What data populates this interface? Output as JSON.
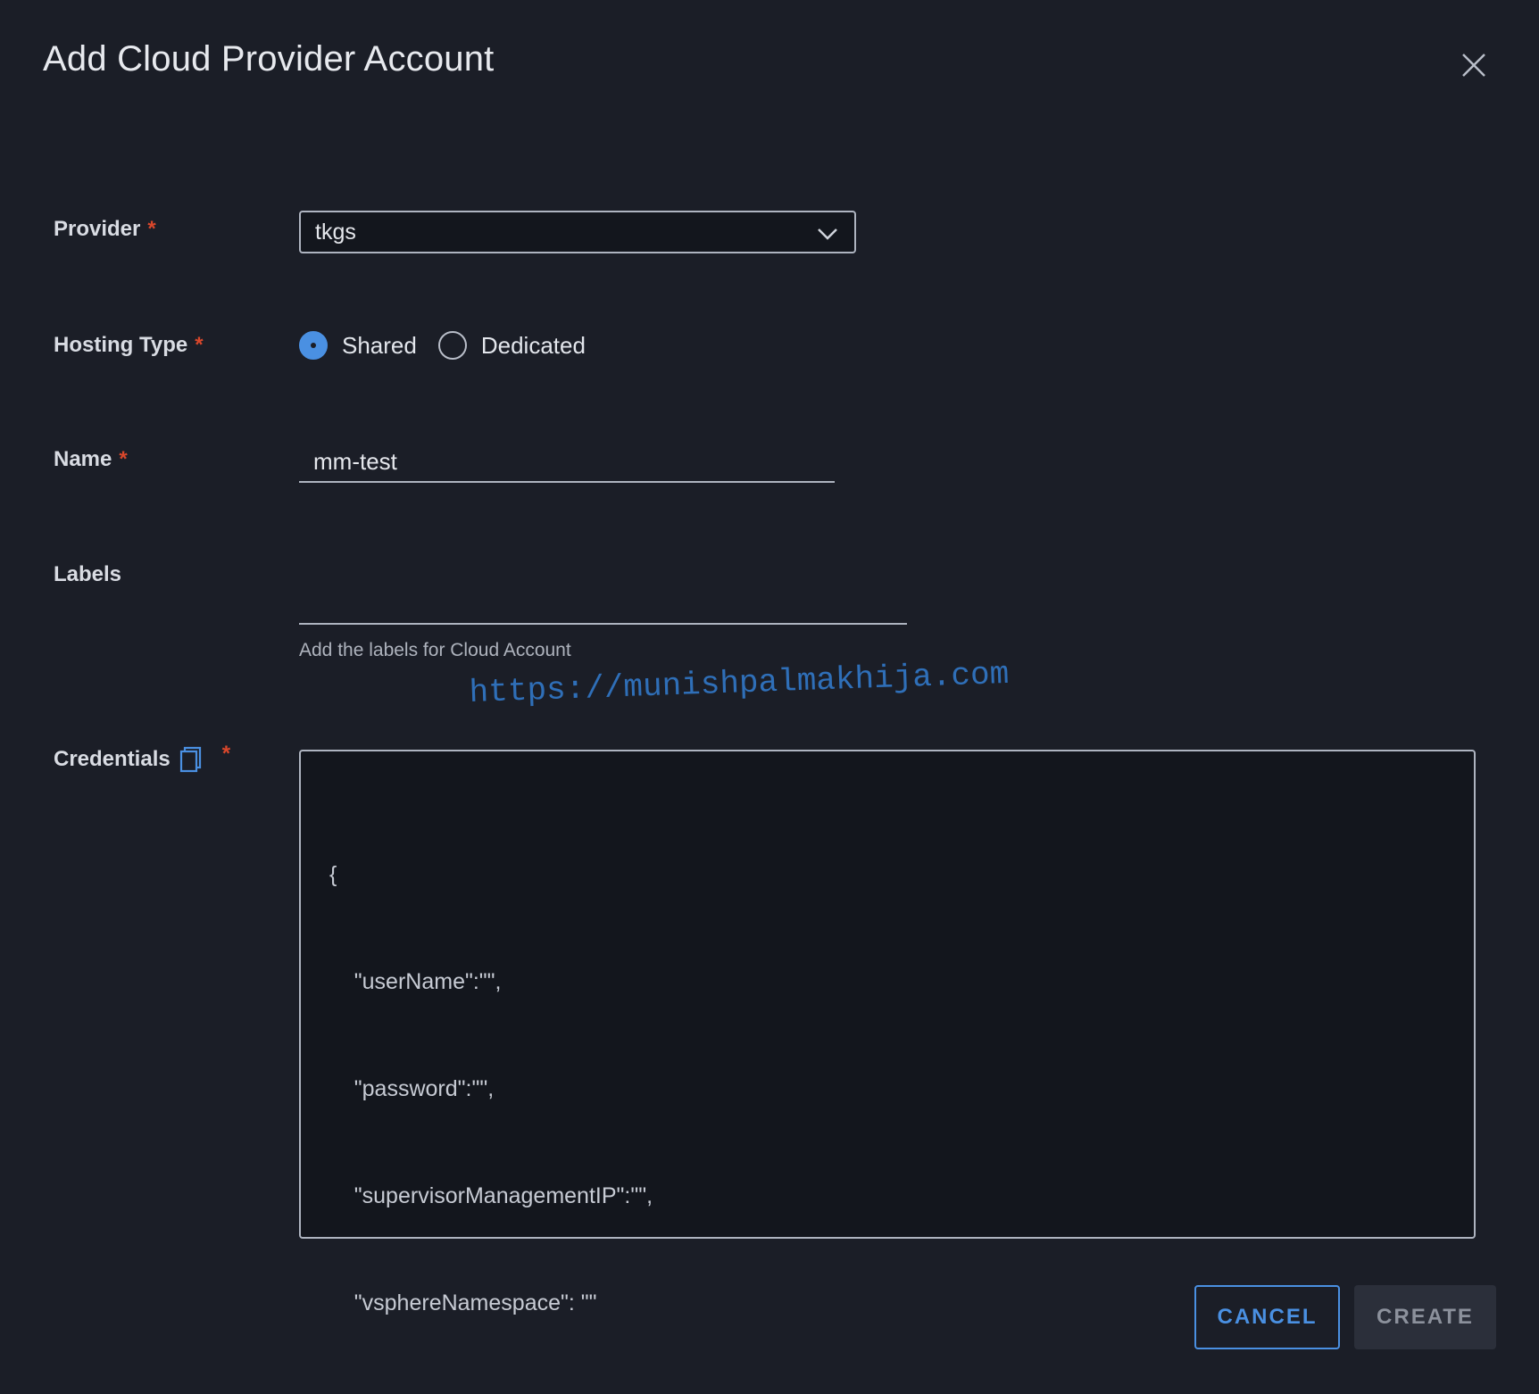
{
  "dialog": {
    "title": "Add Cloud Provider Account"
  },
  "form": {
    "provider": {
      "label": "Provider",
      "required": "*",
      "value": "tkgs"
    },
    "hosting_type": {
      "label": "Hosting Type",
      "required": "*",
      "options": [
        "Shared",
        "Dedicated"
      ],
      "selected": "Shared"
    },
    "name": {
      "label": "Name",
      "required": "*",
      "value": "mm-test"
    },
    "labels": {
      "label": "Labels",
      "value": "",
      "helper": "Add the labels for Cloud Account"
    },
    "credentials": {
      "label": "Credentials",
      "required": "*",
      "lines": [
        "{",
        "    \"userName\":\"\",",
        "    \"password\":\"\",",
        "    \"supervisorManagementIP\":\"\",",
        "    \"vsphereNamespace\": \"\"",
        "  }"
      ]
    }
  },
  "watermark": "https://munishpalmakhija.com",
  "footer": {
    "cancel_label": "CANCEL",
    "create_label": "CREATE"
  },
  "icons": {
    "close": "close-icon",
    "dropdown": "chevron-down-icon",
    "copy": "copy-icon"
  },
  "colors": {
    "background": "#1b1e27",
    "accent": "#4a90e2",
    "required": "#d9472b",
    "watermark": "#2f6fb8"
  }
}
